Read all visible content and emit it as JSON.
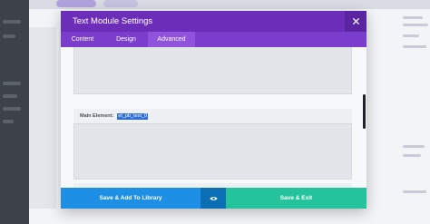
{
  "modal": {
    "title": "Text Module Settings",
    "tabs": [
      {
        "label": "Content",
        "active": false
      },
      {
        "label": "Design",
        "active": false
      },
      {
        "label": "Advanced",
        "active": true
      }
    ],
    "main_element": {
      "label": "Main Element:",
      "value": "et_pb_text_0"
    },
    "footer": {
      "save_library_label": "Save & Add To Library",
      "preview_icon": "eye-icon",
      "save_exit_label": "Save & Exit"
    }
  },
  "icons": {
    "close": "close-icon",
    "preview": "eye-icon"
  },
  "colors": {
    "header": "#6c2eb9",
    "tabs": "#7b3dcb",
    "active_tab": "#8f54db",
    "save_library": "#1d8fe4",
    "preview": "#0c6fb6",
    "save_exit": "#25c39c",
    "selection": "#2f6fd6"
  }
}
